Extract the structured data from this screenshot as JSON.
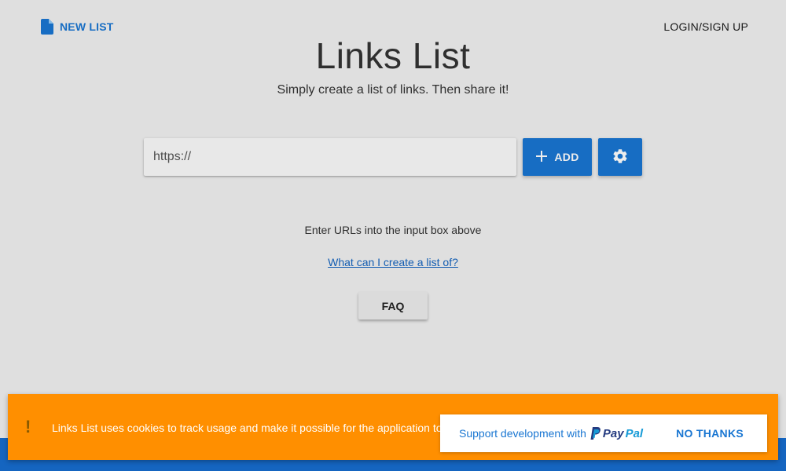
{
  "nav": {
    "new_list_label": "NEW LIST",
    "login_label": "LOGIN/SIGN UP"
  },
  "hero": {
    "title": "Links List",
    "subtitle": "Simply create a list of links. Then share it!"
  },
  "input": {
    "placeholder": "https://",
    "value": ""
  },
  "buttons": {
    "add_label": "ADD",
    "add_icon": "plus-icon",
    "settings_icon": "gear-icon",
    "faq_label": "FAQ"
  },
  "helper": {
    "text": "Enter URLs into the input box above",
    "link": "What can I create a list of?"
  },
  "cookie": {
    "icon": "exclamation-icon",
    "text": "Links List uses cookies to track usage and make it possible for the application to",
    "support_text": "Support development with",
    "paypal_pay": "Pay",
    "paypal_pal": "Pal",
    "no_thanks_label": "NO THANKS"
  },
  "colors": {
    "primary": "#1976d2",
    "banner": "#ff8f00",
    "background": "#f0f0f0"
  }
}
